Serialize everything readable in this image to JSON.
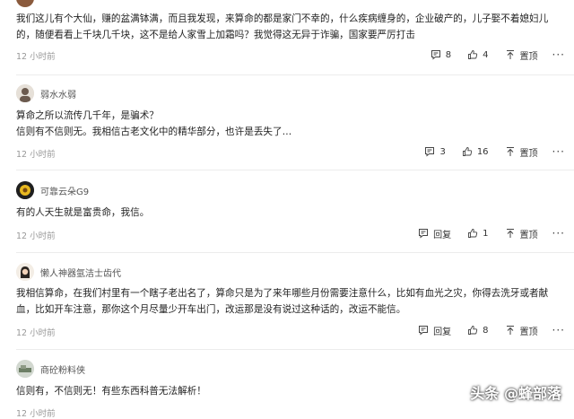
{
  "comments": [
    {
      "username": "",
      "text": "我们这儿有个大仙，赚的盆满钵满，而且我发现，来算命的都是家门不幸的，什么疾病缠身的，企业破产的，儿子娶不着媳妇儿的，随便看看上千块几千块，这不是给人家雪上加霜吗？我觉得这无异于诈骗，国家要严厉打击",
      "time": "12 小时前",
      "reply_label": "8",
      "like_count": "4",
      "pin_label": "置顶"
    },
    {
      "username": "弱水水弱",
      "text": "算命之所以流传几千年，是骗术？\n信则有不信则无。我相信古老文化中的精华部分，也许是丢失了…",
      "time": "12 小时前",
      "reply_label": "3",
      "like_count": "16",
      "pin_label": "置顶"
    },
    {
      "username": "可靠云朵G9",
      "text": "有的人天生就是富贵命，我信。",
      "time": "12 小时前",
      "reply_label": "回复",
      "like_count": "1",
      "pin_label": "置顶"
    },
    {
      "username": "懒人神器氩洁士齿代",
      "text": "我相信算命，在我们村里有一个瞎子老出名了，算命只是为了来年哪些月份需要注意什么，比如有血光之灾，你得去洗牙或者献血，比如开车注意，那你这个月尽量少开车出门，改运那是没有说过这种话的，改运不能信。",
      "time": "12 小时前",
      "reply_label": "回复",
      "like_count": "8",
      "pin_label": "置顶"
    },
    {
      "username": "商砼粉料侠",
      "text": "信则有，不信则无！有些东西科普无法解析！",
      "time": "12 小时前",
      "reply_label": "",
      "like_count": "",
      "pin_label": ""
    }
  ],
  "more_label": "···",
  "watermark": "头条 @蜂部落",
  "colors": {
    "text": "#222222",
    "muted": "#999999",
    "divider": "#ececec"
  },
  "icons": {
    "reply": "comment-icon",
    "like": "thumbs-up-icon",
    "pin": "pin-top-icon",
    "more": "more-icon"
  }
}
